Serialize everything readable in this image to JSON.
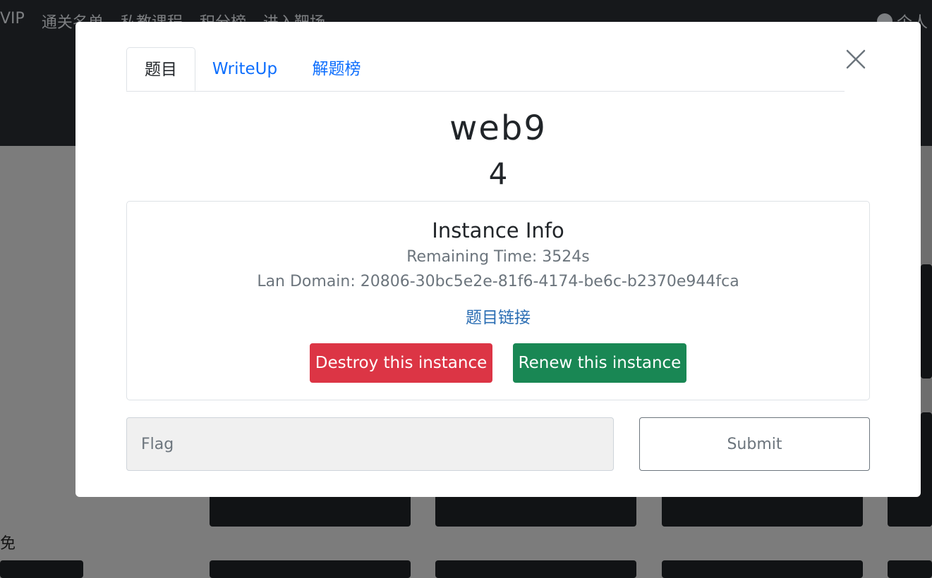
{
  "background": {
    "nav_items": [
      "VIP",
      "通关名单",
      "私教课程",
      "积分榜",
      "进入靶场"
    ],
    "user_label": "个人",
    "section_label": "限免"
  },
  "modal": {
    "tabs": [
      {
        "label": "题目",
        "active": true
      },
      {
        "label": "WriteUp",
        "active": false
      },
      {
        "label": "解题榜",
        "active": false
      }
    ],
    "close_icon": "close-icon",
    "challenge_name": "web9",
    "challenge_score": "4",
    "instance": {
      "title": "Instance Info",
      "remaining_time": "Remaining Time: 3524s",
      "lan_domain": "Lan Domain: 20806-30bc5e2e-81f6-4174-be6c-b2370e944fca",
      "link_label": "题目链接",
      "destroy_label": "Destroy this instance",
      "renew_label": "Renew this instance"
    },
    "flag": {
      "placeholder": "Flag",
      "value": ""
    },
    "submit_label": "Submit"
  },
  "colors": {
    "danger": "#dc3545",
    "success": "#198754",
    "link": "#0d6efd"
  }
}
